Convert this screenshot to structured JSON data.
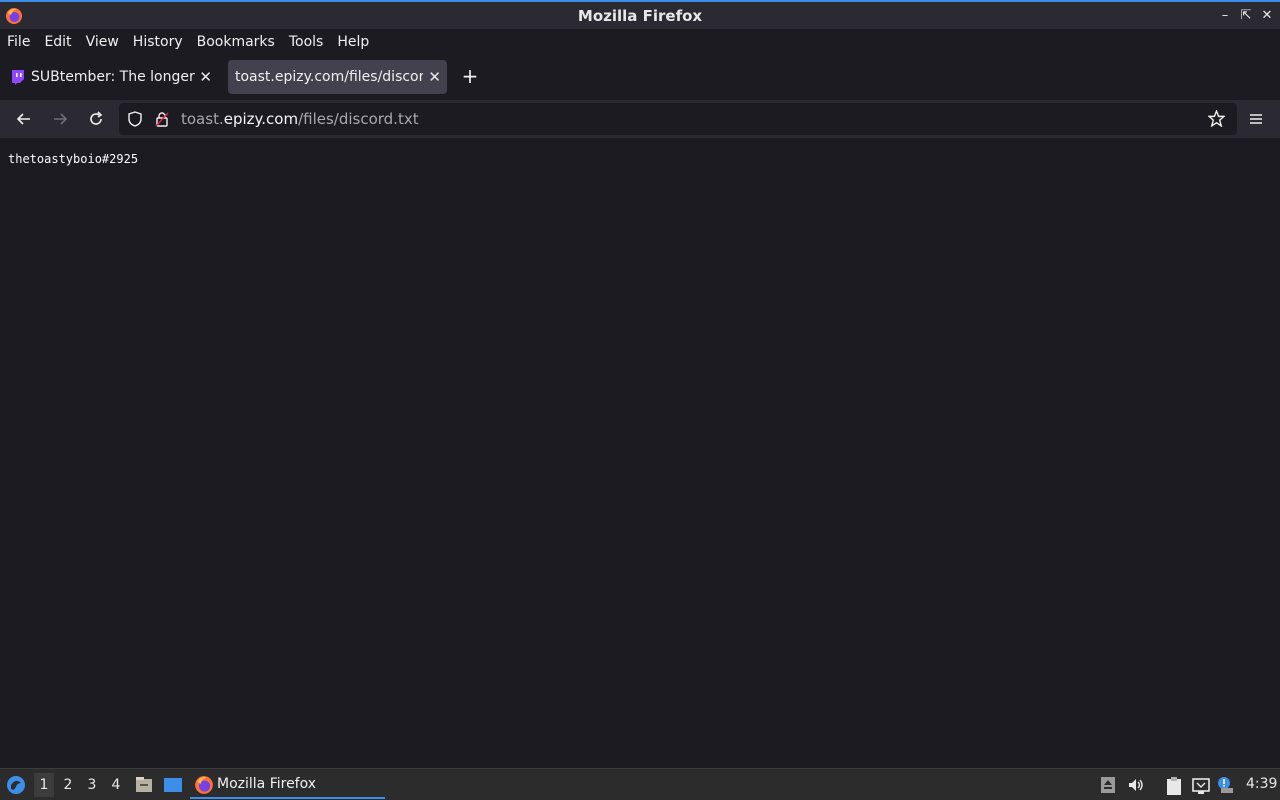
{
  "window": {
    "title": "Mozilla Firefox"
  },
  "menu": [
    "File",
    "Edit",
    "View",
    "History",
    "Bookmarks",
    "Tools",
    "Help"
  ],
  "tabs": [
    {
      "label": "SUBtember: The longer tl",
      "active": false,
      "icon": "twitch-icon"
    },
    {
      "label": "toast.epizy.com/files/discord.txt",
      "active": true,
      "icon": "none"
    }
  ],
  "address": {
    "prefix": "toast.",
    "host": "epizy.com",
    "path": "/files/discord.txt"
  },
  "page": {
    "text": "thetoastyboio#2925"
  },
  "taskbar": {
    "workspaces": [
      "1",
      "2",
      "3",
      "4"
    ],
    "active_workspace": "1",
    "app_label": "Mozilla Firefox",
    "clock": "4:39"
  },
  "colors": {
    "accent": "#3d8ee8",
    "titlebar": "#2b2a33",
    "background": "#1c1b22"
  }
}
